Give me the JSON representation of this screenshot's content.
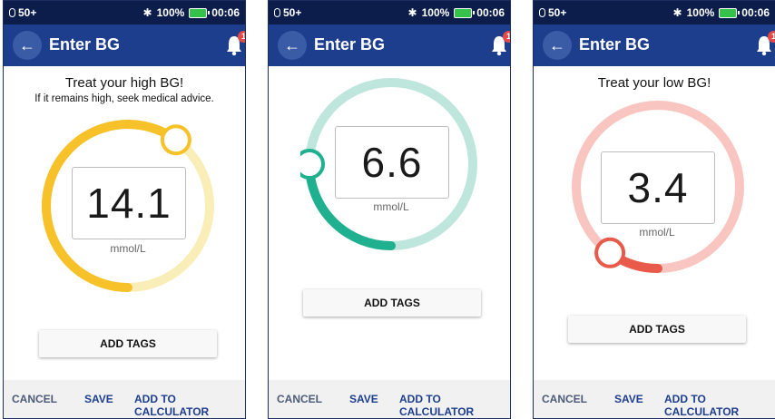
{
  "status": {
    "pods": "50+",
    "battery": "100%",
    "time": "00:06"
  },
  "appbar": {
    "title": "Enter BG",
    "notification_count": "1"
  },
  "screens": [
    {
      "message": "Treat your high BG!",
      "sub_message": "If it remains high, seek medical advice.",
      "value": "14.1",
      "unit": "mmol/L",
      "gauge_fraction": 0.6,
      "accent_color": "#f7c12a",
      "track_color": "#faeeb8",
      "tags_label": "ADD TAGS"
    },
    {
      "message": "",
      "sub_message": "",
      "value": "6.6",
      "unit": "mmol/L",
      "gauge_fraction": 0.25,
      "accent_color": "#1fb08f",
      "track_color": "#bfe6dc",
      "tags_label": "ADD TAGS"
    },
    {
      "message": "Treat your low BG!",
      "sub_message": "",
      "value": "3.4",
      "unit": "mmol/L",
      "gauge_fraction": 0.1,
      "accent_color": "#e85b4a",
      "track_color": "#f8c5c0",
      "tags_label": "ADD TAGS"
    }
  ],
  "footer": {
    "cancel": "CANCEL",
    "save": "SAVE",
    "add_to_calculator": "ADD TO CALCULATOR"
  }
}
